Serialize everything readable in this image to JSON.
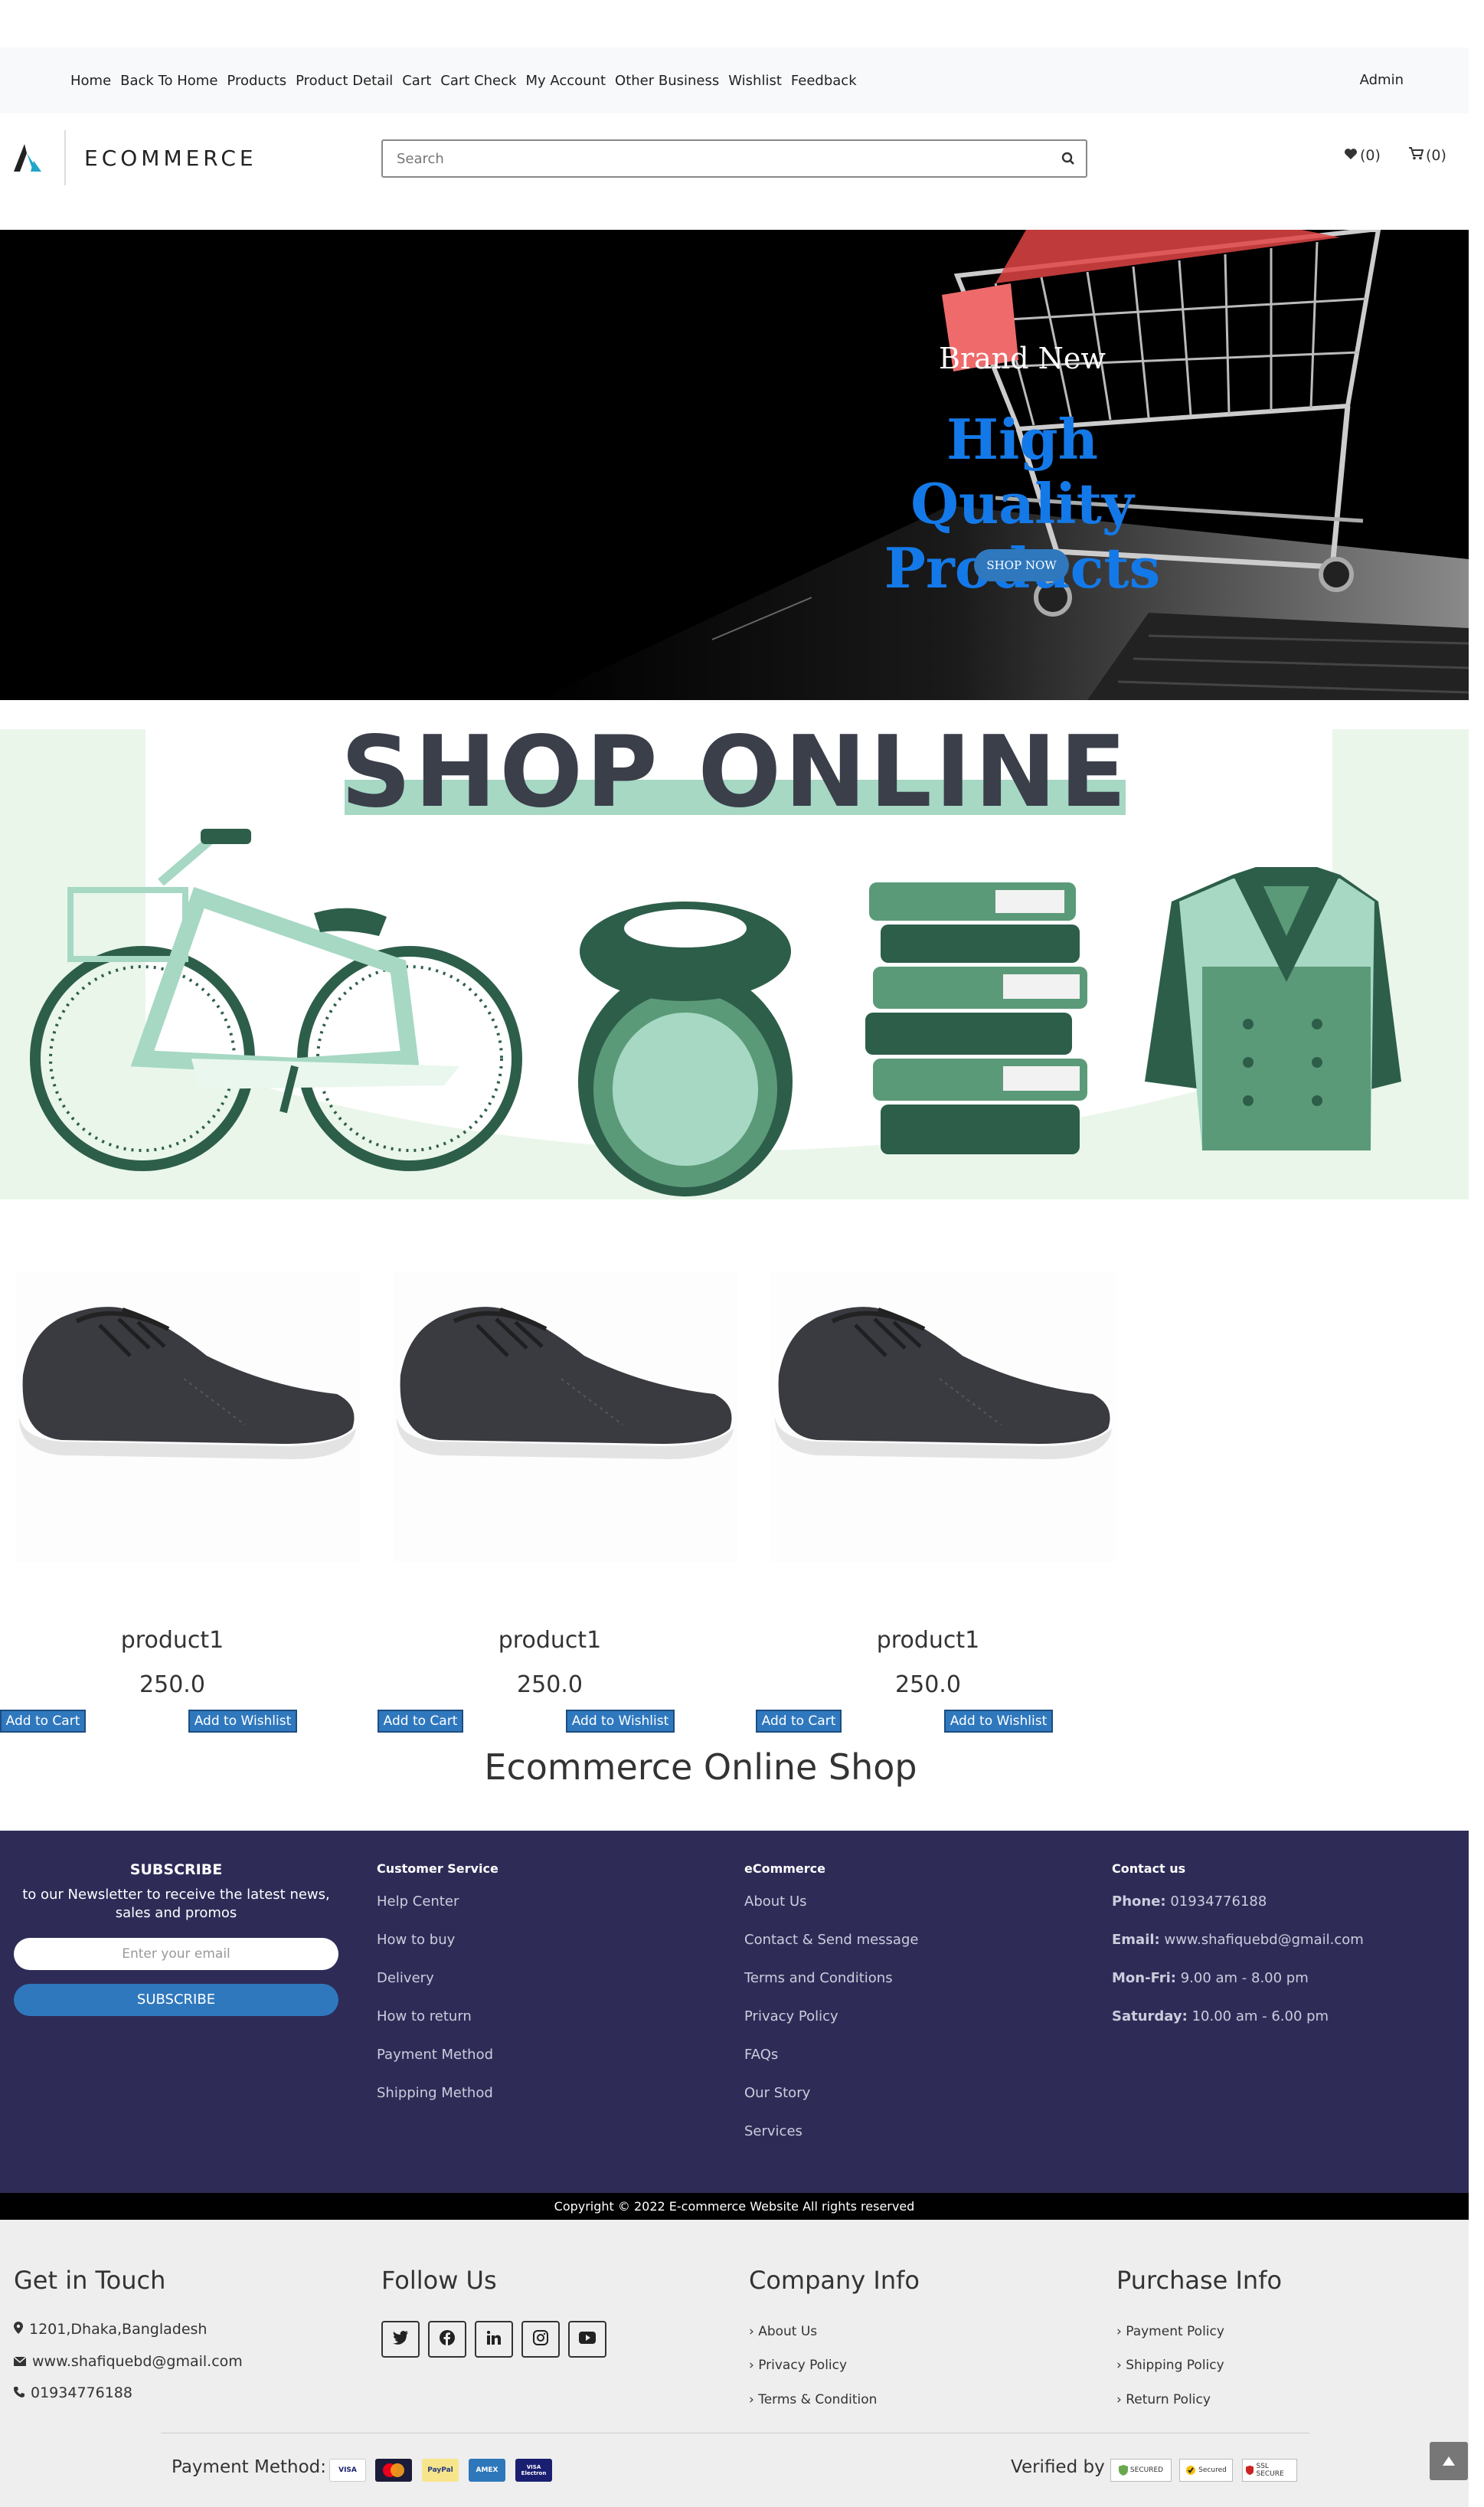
{
  "nav": {
    "links": [
      "Home",
      "Back To Home",
      "Products",
      "Product Detail",
      "Cart",
      "Cart Check",
      "My Account",
      "Other Business",
      "Wishlist",
      "Feedback"
    ],
    "admin": "Admin"
  },
  "header": {
    "brand": "ECOMMERCE",
    "search_placeholder": "Search",
    "wishlist_count": "(0)",
    "cart_count": "(0)"
  },
  "hero": {
    "subtitle": "Brand New",
    "title_line1": "High Quality",
    "title_line2": "Products",
    "cta": "SHOP NOW"
  },
  "banner": {
    "title": "SHOP ONLINE"
  },
  "products": [
    {
      "name": "product1",
      "price": "250.0",
      "add_cart": "Add to Cart",
      "add_wishlist": "Add to Wishlist"
    },
    {
      "name": "product1",
      "price": "250.0",
      "add_cart": "Add to Cart",
      "add_wishlist": "Add to Wishlist"
    },
    {
      "name": "product1",
      "price": "250.0",
      "add_cart": "Add to Cart",
      "add_wishlist": "Add to Wishlist"
    }
  ],
  "shop_title": "Ecommerce Online Shop",
  "footer": {
    "subscribe": {
      "title": "SUBSCRIBE",
      "text": "to our Newsletter to receive the latest news, sales and promos",
      "placeholder": "Enter your email",
      "button": "SUBSCRIBE"
    },
    "customer_service": {
      "title": "Customer Service",
      "items": [
        "Help Center",
        "How to buy",
        "Delivery",
        "How to return",
        "Payment Method",
        "Shipping Method"
      ]
    },
    "ecommerce": {
      "title": "eCommerce",
      "items": [
        "About Us",
        "Contact & Send message",
        "Terms and Conditions",
        "Privacy Policy",
        "FAQs",
        "Our Story",
        "Services"
      ]
    },
    "contact": {
      "title": "Contact us",
      "phone_label": "Phone:",
      "phone": "01934776188",
      "email_label": "Email:",
      "email": "www.shafiquebd@gmail.com",
      "monfri_label": "Mon-Fri:",
      "monfri": "9.00 am - 8.00 pm",
      "sat_label": "Saturday:",
      "sat": "10.00 am - 6.00 pm"
    },
    "copyright": "Copyright © 2022 E-commerce Website All rights reserved"
  },
  "bottom": {
    "get_in_touch": {
      "title": "Get in Touch",
      "address": "1201,Dhaka,Bangladesh",
      "email": "www.shafiquebd@gmail.com",
      "phone": "01934776188"
    },
    "follow_us": {
      "title": "Follow Us"
    },
    "company_info": {
      "title": "Company Info",
      "items": [
        "About Us",
        "Privacy Policy",
        "Terms & Condition"
      ]
    },
    "purchase_info": {
      "title": "Purchase Info",
      "items": [
        "Payment Policy",
        "Shipping Policy",
        "Return Policy"
      ]
    },
    "payment_label": "Payment Method:",
    "cards": [
      "VISA",
      "MasterCard",
      "PayPal",
      "AMEX",
      "VISA Electron"
    ],
    "verified_label": "Verified by",
    "badges": [
      "SECURED",
      "Secured",
      "SSL SECURE"
    ]
  },
  "colors": {
    "footer_bg": "#2e2c57",
    "accent_blue": "#2f78be",
    "hero_title": "#1479e8",
    "banner_bg": "#eaf6ea",
    "banner_green_dark": "#2d5e4a",
    "banner_green_mid": "#5b9a78",
    "banner_green_light": "#a6d8c4"
  }
}
